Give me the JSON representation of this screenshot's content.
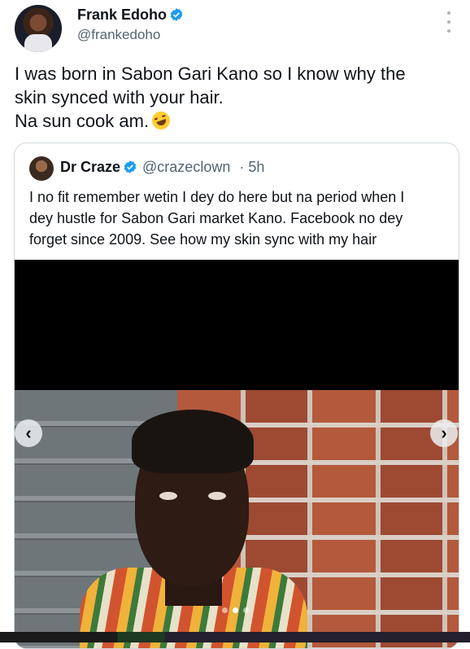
{
  "author": {
    "name": "Frank Edoho",
    "handle": "@frankedoho"
  },
  "tweet": {
    "lines": [
      "I was born in Sabon Gari Kano so I know why the",
      "skin synced with your hair.",
      "Na sun cook am."
    ],
    "emoji": "rolling-on-floor-laughing-emoji"
  },
  "quote": {
    "name": "Dr Craze",
    "handle": "@crazeclown",
    "time": "· 5h",
    "lines": [
      "I no fit remember wetin I dey do here but na period when I",
      "dey hustle for Sabon Gari market Kano. Facebook no dey",
      "forget since 2009. See how my skin sync with my hair"
    ],
    "carousel": {
      "prev_icon": "‹",
      "next_icon": "›",
      "slide_count": 3,
      "active_index": 1
    }
  },
  "colors": {
    "verified": "#1d9bf0",
    "text": "#0f1419",
    "secondary": "#536471",
    "border": "#cfd9de"
  }
}
